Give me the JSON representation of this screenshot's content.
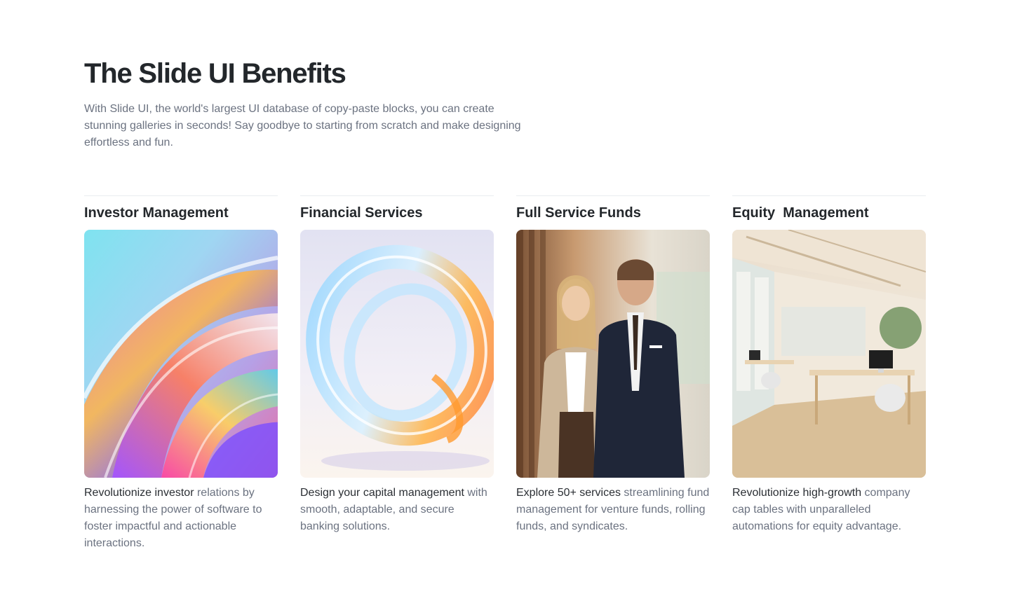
{
  "header": {
    "title": "The Slide UI Benefits",
    "description": "With Slide UI, the world's largest UI database of copy-paste blocks, you can create stunning galleries in seconds! Say goodbye to starting from scratch and make designing effortless and fun."
  },
  "cards": [
    {
      "title": "Investor Management",
      "desc_lead": "Revolutionize investor",
      "desc_rest": " relations by harnessing the power of software to foster impactful and actionable interactions."
    },
    {
      "title": "Financial Services",
      "desc_lead": "Design your capital management",
      "desc_rest": " with smooth, adaptable, and secure banking solutions."
    },
    {
      "title": "Full Service Funds",
      "desc_lead": "Explore 50+ services",
      "desc_rest": " streamlining fund management for venture funds, rolling funds, and syndicates."
    },
    {
      "title": "Equity  Management",
      "desc_lead": "Revolutionize high-growth",
      "desc_rest": " company cap tables with unparalleled automations for equity advantage."
    }
  ],
  "colors": {
    "heading": "#23272b",
    "body_text": "#6b7280",
    "lead_text": "#2a2e33",
    "divider": "#e9ecef"
  }
}
